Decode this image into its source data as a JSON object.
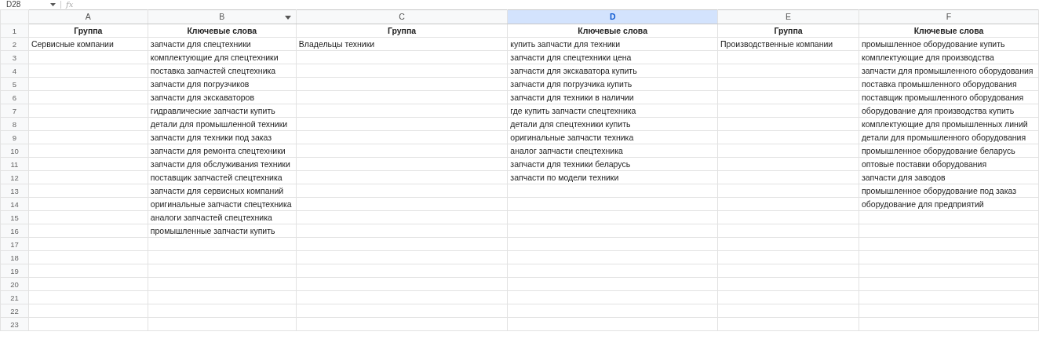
{
  "formula_bar": {
    "name_box": "D28",
    "formula_label": "fx"
  },
  "columns": [
    {
      "label": "A",
      "selected": false,
      "filter": false
    },
    {
      "label": "B",
      "selected": false,
      "filter": true
    },
    {
      "label": "C",
      "selected": false,
      "filter": false
    },
    {
      "label": "D",
      "selected": true,
      "filter": false
    },
    {
      "label": "E",
      "selected": false,
      "filter": false
    },
    {
      "label": "F",
      "selected": false,
      "filter": false
    }
  ],
  "rows": [
    {
      "number": "1",
      "kind": "header",
      "cells": [
        "Группа",
        "Ключевые слова",
        "Группа",
        "Ключевые слова",
        "Группа",
        "Ключевые слова"
      ]
    },
    {
      "number": "2",
      "kind": "data",
      "cells": [
        "Сервисные компании",
        "запчасти для спецтехники",
        "Владельцы техники",
        "купить запчасти для техники",
        "Производственные компании",
        "промышленное оборудование купить"
      ]
    },
    {
      "number": "3",
      "kind": "data",
      "cells": [
        null,
        "комплектующие для спецтехники",
        null,
        "запчасти для спецтехники цена",
        null,
        "комплектующие для производства"
      ]
    },
    {
      "number": "4",
      "kind": "data",
      "cells": [
        null,
        "поставка запчастей спецтехника",
        null,
        "запчасти для экскаватора купить",
        null,
        "запчасти для промышленного оборудования"
      ]
    },
    {
      "number": "5",
      "kind": "data",
      "cells": [
        null,
        "запчасти для погрузчиков",
        null,
        "запчасти для погрузчика купить",
        null,
        "поставка промышленного оборудования"
      ]
    },
    {
      "number": "6",
      "kind": "data",
      "cells": [
        null,
        "запчасти для экскаваторов",
        null,
        "запчасти для техники в наличии",
        null,
        "поставщик промышленного оборудования"
      ]
    },
    {
      "number": "7",
      "kind": "data",
      "cells": [
        null,
        "гидравлические запчасти купить",
        null,
        "где купить запчасти спецтехника",
        null,
        "оборудование для производства купить"
      ]
    },
    {
      "number": "8",
      "kind": "data",
      "cells": [
        null,
        "детали для промышленной техники",
        null,
        "детали для спецтехники купить",
        null,
        "комплектующие для промышленных линий"
      ]
    },
    {
      "number": "9",
      "kind": "data",
      "cells": [
        null,
        "запчасти для техники под заказ",
        null,
        "оригинальные запчасти техника",
        null,
        "детали для промышленного оборудования"
      ]
    },
    {
      "number": "10",
      "kind": "data",
      "cells": [
        null,
        "запчасти для ремонта спецтехники",
        null,
        "аналог запчасти спецтехника",
        null,
        "промышленное оборудование беларусь"
      ]
    },
    {
      "number": "11",
      "kind": "data",
      "cells": [
        null,
        "запчасти для обслуживания техники",
        null,
        "запчасти для техники беларусь",
        null,
        "оптовые поставки оборудования"
      ]
    },
    {
      "number": "12",
      "kind": "data",
      "cells": [
        null,
        "поставщик запчастей спецтехника",
        null,
        "запчасти по модели техники",
        null,
        "запчасти для заводов"
      ]
    },
    {
      "number": "13",
      "kind": "data",
      "cells": [
        null,
        "запчасти для сервисных компаний",
        null,
        null,
        null,
        "промышленное оборудование под заказ"
      ]
    },
    {
      "number": "14",
      "kind": "data",
      "cells": [
        null,
        "оригинальные запчасти спецтехника",
        null,
        null,
        null,
        "оборудование для предприятий"
      ]
    },
    {
      "number": "15",
      "kind": "data",
      "cells": [
        null,
        "аналоги запчастей спецтехника",
        null,
        null,
        null,
        null
      ]
    },
    {
      "number": "16",
      "kind": "data",
      "cells": [
        null,
        "промышленные запчасти купить",
        null,
        null,
        null,
        null
      ]
    },
    {
      "number": "17",
      "kind": "data",
      "cells": [
        null,
        null,
        null,
        null,
        null,
        null
      ]
    },
    {
      "number": "18",
      "kind": "data",
      "cells": [
        null,
        null,
        null,
        null,
        null,
        null
      ]
    },
    {
      "number": "19",
      "kind": "data",
      "cells": [
        null,
        null,
        null,
        null,
        null,
        null
      ]
    },
    {
      "number": "20",
      "kind": "data",
      "cells": [
        null,
        null,
        null,
        null,
        null,
        null
      ]
    },
    {
      "number": "21",
      "kind": "data",
      "cells": [
        null,
        null,
        null,
        null,
        null,
        null
      ]
    },
    {
      "number": "22",
      "kind": "data",
      "cells": [
        null,
        null,
        null,
        null,
        null,
        null
      ]
    },
    {
      "number": "23",
      "kind": "data",
      "cells": [
        null,
        null,
        null,
        null,
        null,
        null
      ]
    }
  ]
}
